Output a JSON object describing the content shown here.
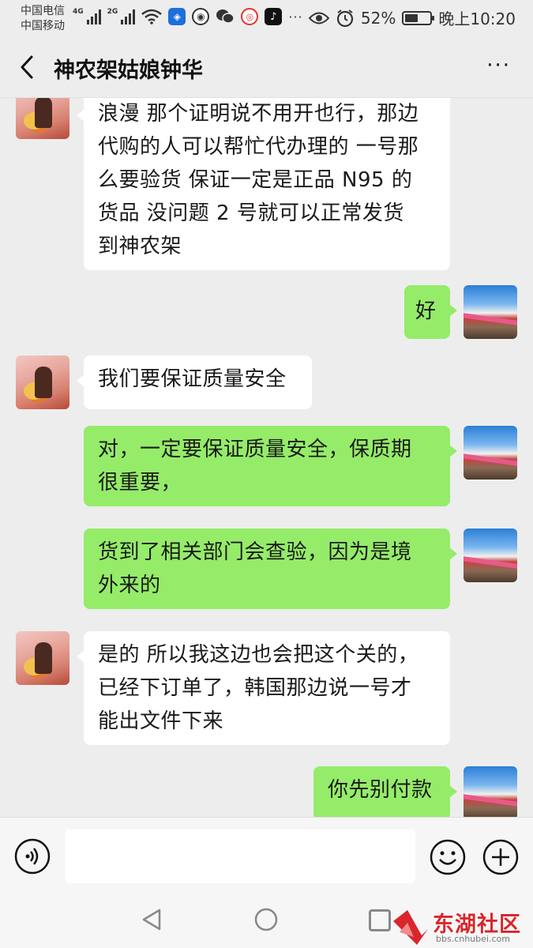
{
  "status_bar": {
    "carrier_1": "中国电信",
    "carrier_2": "中国移动",
    "network_1": "4G",
    "network_2": "2G",
    "app_icons": [
      "wifi-icon",
      "shield-icon",
      "browser-icon",
      "wechat-icon",
      "weibo-icon",
      "tiktok-icon"
    ],
    "more_dots": "···",
    "battery_text": "52%",
    "battery_level": 0.52,
    "time": "晚上10:20"
  },
  "header": {
    "title": "神农架姑娘钟华",
    "more": "···"
  },
  "messages": [
    {
      "from": "them",
      "lines": [
        "浪漫 那个证明说不用开也行，那边",
        "代购的人可以帮忙代办理的 一号那",
        "么要验货 保证一定是正品 N95 的",
        "货品 没问题  2 号就可以正常发货",
        "到神农架"
      ]
    },
    {
      "from": "me",
      "lines": [
        "好"
      ]
    },
    {
      "from": "them",
      "lines": [
        "我们要保证质量安全"
      ]
    },
    {
      "from": "me",
      "lines": [
        "对，一定要保证质量安全，保质期",
        "很重要，"
      ]
    },
    {
      "from": "me",
      "lines": [
        "货到了相关部门会查验，因为是境",
        "外来的"
      ]
    },
    {
      "from": "them",
      "lines": [
        "是的 所以我这边也会把这个关的，",
        "已经下订单了，韩国那边说一号才",
        "能出文件下来"
      ]
    },
    {
      "from": "me",
      "lines": [
        "你先别付款"
      ]
    }
  ],
  "input": {
    "placeholder": ""
  },
  "watermark": {
    "text": "东湖社区",
    "url": "bbs.cnhubei.com"
  },
  "colors": {
    "background": "#ededed",
    "outgoing_bubble": "#95ec69",
    "incoming_bubble": "#ffffff",
    "watermark_red": "#d9262c"
  }
}
